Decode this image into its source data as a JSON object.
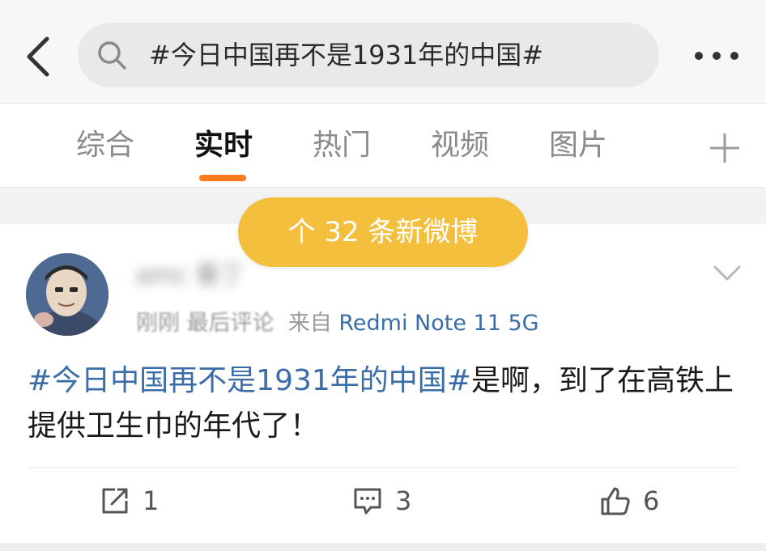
{
  "header": {
    "search_query": "#今日中国再不是1931年的中国#"
  },
  "tabs": [
    {
      "label": "综合"
    },
    {
      "label": "实时"
    },
    {
      "label": "热门"
    },
    {
      "label": "视频"
    },
    {
      "label": "图片"
    }
  ],
  "active_tab": "实时",
  "new_posts_banner": "个 32 条新微博",
  "post": {
    "username": "amc 看丁",
    "meta_time": "刚刚",
    "meta_comment": "最后评论",
    "meta_source_prefix": "来自",
    "meta_device": "Redmi Note 11 5G",
    "hashtag": "#今日中国再不是1931年的中国#",
    "text": "是啊，到了在高铁上提供卫生巾的年代了！",
    "reposts": "1",
    "comments": "3",
    "likes": "6"
  },
  "colors": {
    "accent_orange": "#ff7a1a",
    "banner_yellow": "#f5bf3e",
    "link_blue": "#3a6da8"
  },
  "icons": [
    "back-arrow-icon",
    "search-icon",
    "more-icon",
    "plus-icon",
    "chevron-down-icon",
    "repost-icon",
    "comment-icon",
    "like-icon"
  ]
}
